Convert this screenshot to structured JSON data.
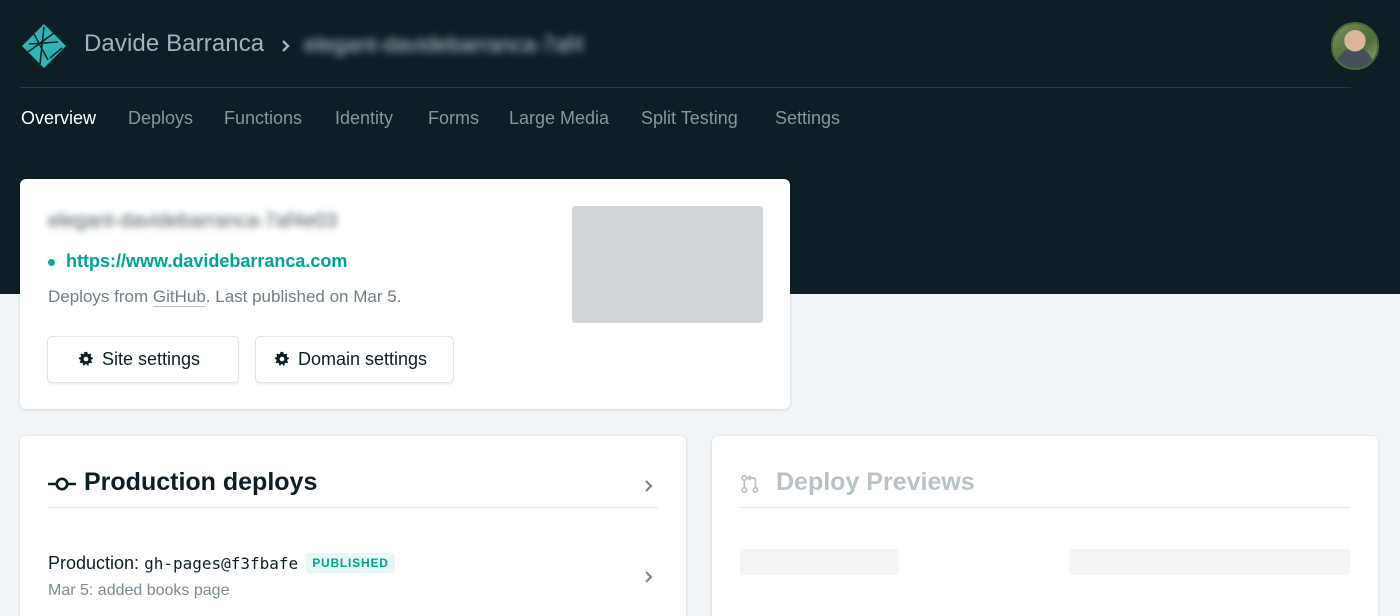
{
  "header": {
    "team_name": "Davide Barranca",
    "site_name_obscured": "elegant-davidebarranca-7af4e03",
    "avatar_alt": "User avatar"
  },
  "nav": {
    "items": [
      {
        "label": "Overview",
        "active": true
      },
      {
        "label": "Deploys",
        "active": false
      },
      {
        "label": "Functions",
        "active": false
      },
      {
        "label": "Identity",
        "active": false
      },
      {
        "label": "Forms",
        "active": false
      },
      {
        "label": "Large Media",
        "active": false
      },
      {
        "label": "Split Testing",
        "active": false
      },
      {
        "label": "Settings",
        "active": false
      }
    ]
  },
  "site_card": {
    "title_obscured": "elegant-davidebarranca-7af4e03",
    "url": "https://www.davidebarranca.com",
    "deploy_prefix": "Deploys from ",
    "deploy_source": "GitHub",
    "deploy_suffix": ". Last published on Mar 5.",
    "site_settings_label": "Site settings",
    "domain_settings_label": "Domain settings"
  },
  "production": {
    "title": "Production deploys",
    "row_label": "Production: ",
    "row_ref": "gh-pages@f3fbafe",
    "badge": "PUBLISHED",
    "row_sub": "Mar 5: added books page"
  },
  "previews": {
    "title": "Deploy Previews"
  },
  "colors": {
    "topbar": "#0e1e25",
    "accent": "#00ad9f",
    "nav_inactive": "#8796a0",
    "page_bg": "#f2f5f7"
  },
  "icons": {
    "logo": "netlify-logo-icon",
    "breadcrumb": "chevron-right-icon",
    "settings": "gear-icon",
    "production": "git-commit-icon",
    "previews": "git-pull-request-icon",
    "row_link": "chevron-right-icon"
  }
}
